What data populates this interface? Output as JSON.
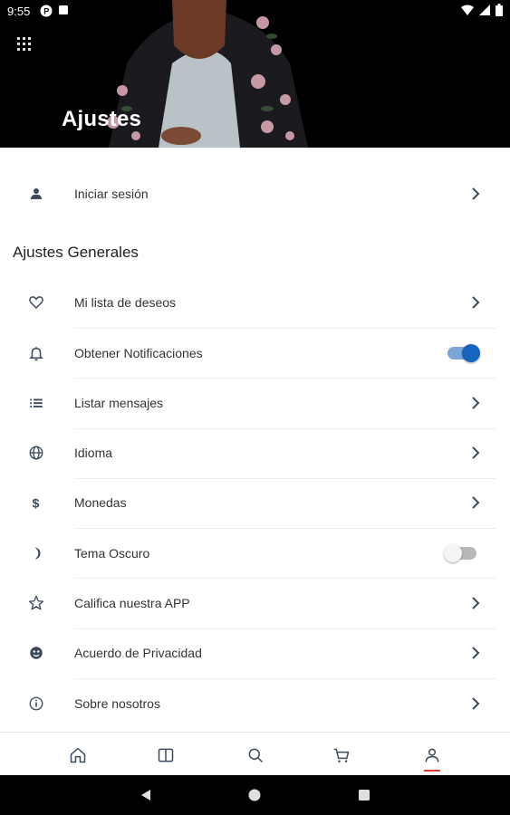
{
  "status_bar": {
    "time": "9:55",
    "notif_icons": [
      "p-icon",
      "square-icon"
    ],
    "right_icons": [
      "wifi-icon",
      "signal-icon",
      "battery-icon"
    ]
  },
  "header": {
    "title": "Ajustes",
    "menu_icon": "grid-icon"
  },
  "login": {
    "label": "Iniciar sesión",
    "icon": "person-icon"
  },
  "section": {
    "title": "Ajustes Generales"
  },
  "items": [
    {
      "label": "Mi lista de deseos",
      "icon": "heart-icon",
      "control": "chevron"
    },
    {
      "label": "Obtener Notificaciones",
      "icon": "bell-icon",
      "control": "toggle",
      "on": true
    },
    {
      "label": "Listar mensajes",
      "icon": "list-icon",
      "control": "chevron"
    },
    {
      "label": "Idioma",
      "icon": "globe-icon",
      "control": "chevron"
    },
    {
      "label": "Monedas",
      "icon": "dollar-icon",
      "control": "chevron"
    },
    {
      "label": "Tema Oscuro",
      "icon": "moon-icon",
      "control": "toggle",
      "on": false
    },
    {
      "label": "Califica nuestra APP",
      "icon": "star-icon",
      "control": "chevron"
    },
    {
      "label": "Acuerdo de Privacidad",
      "icon": "privacy-icon",
      "control": "chevron"
    },
    {
      "label": "Sobre nosotros",
      "icon": "info-icon",
      "control": "chevron"
    }
  ],
  "bottom_nav": [
    {
      "name": "home",
      "icon": "home-icon"
    },
    {
      "name": "categories",
      "icon": "book-icon"
    },
    {
      "name": "search",
      "icon": "search-icon"
    },
    {
      "name": "cart",
      "icon": "cart-icon"
    },
    {
      "name": "profile",
      "icon": "profile-icon",
      "active": true
    }
  ],
  "colors": {
    "accent": "#1565c0",
    "active_underline": "#e53935",
    "icon": "#3c4a5a"
  }
}
